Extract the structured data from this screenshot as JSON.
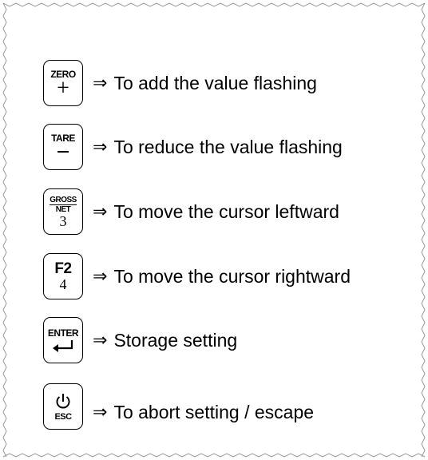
{
  "keys": [
    {
      "top": "ZERO",
      "bottom": "+",
      "arrow": "⇒",
      "label": "To add the value flashing"
    },
    {
      "top": "TARE",
      "bottom": "−",
      "arrow": "⇒",
      "label": "To reduce the value flashing"
    },
    {
      "top": "GROSS",
      "mid": "NET",
      "bottom": "3",
      "arrow": "⇒",
      "label": "To move the cursor leftward"
    },
    {
      "top": "F2",
      "bottom": "4",
      "arrow": "⇒",
      "label": "To move the cursor rightward"
    },
    {
      "top": "ENTER",
      "bottom": "↵",
      "arrow": "⇒",
      "label": "Storage setting"
    },
    {
      "top": "⏻",
      "bottom": "ESC",
      "arrow": "⇒",
      "label": "To abort setting / escape"
    }
  ]
}
